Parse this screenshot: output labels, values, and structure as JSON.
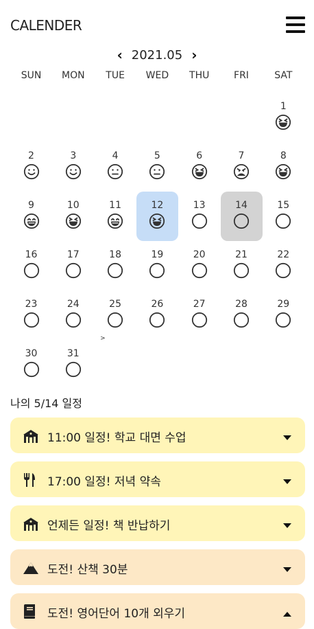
{
  "header": {
    "title": "CALENDER"
  },
  "month": {
    "label": "2021.05"
  },
  "weekdays": [
    "SUN",
    "MON",
    "TUE",
    "WED",
    "THU",
    "FRI",
    "SAT"
  ],
  "weeks": [
    [
      null,
      null,
      null,
      null,
      null,
      null,
      {
        "d": "1",
        "mood": "laugh"
      }
    ],
    [
      {
        "d": "2",
        "mood": "smile"
      },
      {
        "d": "3",
        "mood": "smile"
      },
      {
        "d": "4",
        "mood": "neutral"
      },
      {
        "d": "5",
        "mood": "neutral"
      },
      {
        "d": "6",
        "mood": "laugh"
      },
      {
        "d": "7",
        "mood": "angry"
      },
      {
        "d": "8",
        "mood": "laugh"
      }
    ],
    [
      {
        "d": "9",
        "mood": "grin"
      },
      {
        "d": "10",
        "mood": "laugh"
      },
      {
        "d": "11",
        "mood": "grin"
      },
      {
        "d": "12",
        "mood": "laugh",
        "state": "today"
      },
      {
        "d": "13",
        "mood": "empty"
      },
      {
        "d": "14",
        "mood": "empty",
        "state": "selected"
      },
      {
        "d": "15",
        "mood": "empty"
      }
    ],
    [
      {
        "d": "16",
        "mood": "empty"
      },
      {
        "d": "17",
        "mood": "empty"
      },
      {
        "d": "18",
        "mood": "empty"
      },
      {
        "d": "19",
        "mood": "empty"
      },
      {
        "d": "20",
        "mood": "empty"
      },
      {
        "d": "21",
        "mood": "empty"
      },
      {
        "d": "22",
        "mood": "empty"
      }
    ],
    [
      {
        "d": "23",
        "mood": "empty"
      },
      {
        "d": "24",
        "mood": "empty"
      },
      {
        "d": "25",
        "mood": "empty",
        "caret": ">"
      },
      {
        "d": "26",
        "mood": "empty"
      },
      {
        "d": "27",
        "mood": "empty"
      },
      {
        "d": "28",
        "mood": "empty"
      },
      {
        "d": "29",
        "mood": "empty"
      }
    ],
    [
      {
        "d": "30",
        "mood": "empty"
      },
      {
        "d": "31",
        "mood": "empty"
      },
      null,
      null,
      null,
      null,
      null
    ]
  ],
  "schedule": {
    "title": "나의 5/14 일정",
    "items": [
      {
        "icon": "school-icon",
        "text": "11:00 일정! 학교 대면 수업",
        "color": "yellow",
        "chevron": "down"
      },
      {
        "icon": "utensils-icon",
        "text": "17:00 일정! 저녁 약속",
        "color": "yellow",
        "chevron": "down"
      },
      {
        "icon": "school-icon",
        "text": "언제든 일정! 책 반납하기",
        "color": "yellow",
        "chevron": "down"
      },
      {
        "icon": "mountain-icon",
        "text": "도전! 산책 30분",
        "color": "peach",
        "chevron": "down"
      },
      {
        "icon": "book-icon",
        "text": "도전! 영어단어 10개 외우기",
        "color": "peach",
        "chevron": "up"
      }
    ]
  },
  "colors": {
    "today_bg": "#c6ddf7",
    "selected_bg": "#d3d3d3",
    "yellow": "#fff5b8",
    "peach": "#fde8c6"
  }
}
